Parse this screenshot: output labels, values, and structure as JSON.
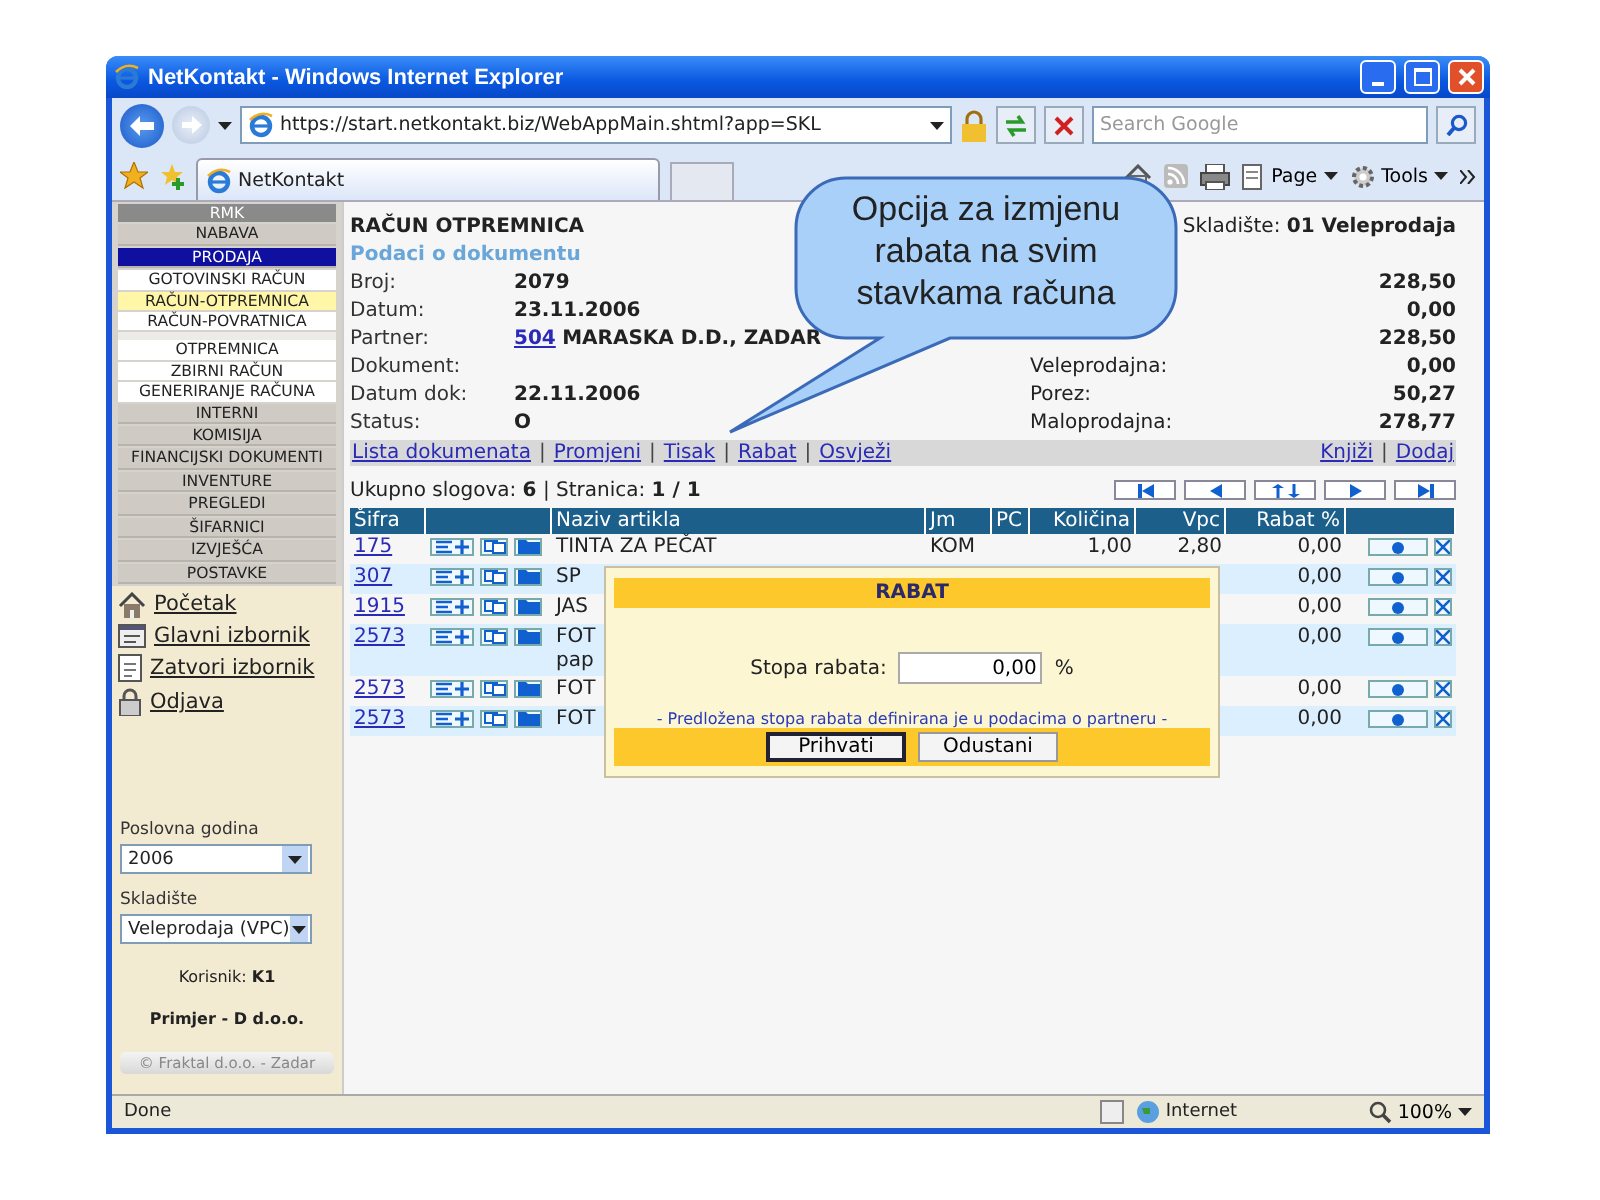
{
  "window": {
    "title": "NetKontakt - Windows Internet Explorer"
  },
  "address_bar": {
    "url": "https://start.netkontakt.biz/WebAppMain.shtml?app=SKL"
  },
  "search": {
    "placeholder": "Search Google"
  },
  "tabs": [
    {
      "label": "NetKontakt",
      "selected": true
    }
  ],
  "command_bar": [
    {
      "label": "Page",
      "kind": "page"
    },
    {
      "label": "Tools",
      "kind": "tools"
    }
  ],
  "sidebar": {
    "menu": [
      {
        "label": "RMK",
        "kind": "header"
      },
      {
        "label": "NABAVA",
        "kind": "category",
        "selected": false
      },
      {
        "label": "PRODAJA",
        "kind": "category",
        "selected": true,
        "children": [
          {
            "label": "GOTOVINSKI RAČUN",
            "selected": false,
            "gap_before": false
          },
          {
            "label": "RAČUN-OTPREMNICA",
            "selected": true,
            "gap_before": false
          },
          {
            "label": "RAČUN-POVRATNICA",
            "selected": false,
            "gap_before": false
          },
          {
            "label": "OTPREMNICA",
            "selected": false,
            "gap_before": true
          },
          {
            "label": "ZBIRNI RAČUN",
            "selected": false,
            "gap_before": false
          },
          {
            "label": "GENERIRANJE RAČUNA",
            "selected": false,
            "gap_before": false
          }
        ]
      },
      {
        "label": "INTERNI",
        "kind": "category",
        "selected": false
      },
      {
        "label": "KOMISIJA",
        "kind": "category",
        "selected": false
      },
      {
        "label": "FINANCIJSKI DOKUMENTI",
        "kind": "category",
        "selected": false
      },
      {
        "label": "INVENTURE",
        "kind": "category",
        "selected": false
      },
      {
        "label": "PREGLEDI",
        "kind": "category",
        "selected": false
      },
      {
        "label": "ŠIFARNICI",
        "kind": "category",
        "selected": false
      },
      {
        "label": "IZVJEŠĆA",
        "kind": "category",
        "selected": false
      },
      {
        "label": "POSTAVKE",
        "kind": "category",
        "selected": false
      }
    ],
    "links": [
      {
        "label": "Početak",
        "kind": "home"
      },
      {
        "label": "Glavni izbornik",
        "kind": "menu"
      },
      {
        "label": "Zatvori izbornik",
        "kind": "close"
      },
      {
        "label": "Odjava",
        "kind": "logout"
      }
    ],
    "year": {
      "label": "Poslovna godina",
      "value": "2006"
    },
    "warehouse": {
      "label": "Skladište",
      "value": "Veleprodaja (VPC)"
    },
    "user": "Korisnik: **K1**",
    "company": "Primjer - D d.o.o.",
    "copyright": "© Fraktal d.o.o. - Zadar"
  },
  "document": {
    "title": "RAČUN OTPREMNICA",
    "warehouse": "Skladište: **01 Veleprodaja**",
    "section": "Podaci o dokumentu",
    "fields_left": [
      {
        "label": "Broj:",
        "value": "2079"
      },
      {
        "label": "Datum:",
        "value": "23.11.2006"
      },
      {
        "label": "Partner:",
        "link": "504",
        "value": "MARASKA D.D., ZADAR"
      },
      {
        "label": "Dokument:"
      },
      {
        "label": "Datum dok:",
        "value": "22.11.2006"
      },
      {
        "label": "Status:",
        "value": "O"
      }
    ],
    "fields_right": [
      {
        "value": "228,50"
      },
      {
        "value": "0,00"
      },
      {
        "value": "228,50"
      },
      {
        "label": "Veleprodajna:",
        "value": "0,00"
      },
      {
        "label": "Porez:",
        "value": "50,27"
      },
      {
        "label": "Maloprodajna:",
        "value": "278,77"
      }
    ],
    "actions_left": [
      "Lista dokumenata",
      "Promjeni",
      "Tisak",
      "Rabat",
      "Osvježi"
    ],
    "actions_right": [
      "Knjiži",
      "Dodaj"
    ],
    "separator": "|",
    "record_info": "Ukupno slogova: **6** | Stranica: **1 / 1**",
    "pager": [
      {
        "kind": "first"
      },
      {
        "kind": "prev"
      },
      {
        "kind": "toggle"
      },
      {
        "kind": "next"
      },
      {
        "kind": "last"
      }
    ],
    "table": {
      "columns": [
        "Šifra",
        "Naziv artikla",
        "Jm",
        "PC",
        "Količina",
        "Vpc",
        "Rabat %"
      ],
      "rows": [
        {
          "code": "175",
          "name": "TINTA ZA PEČAT",
          "unit": "KOM",
          "qty": "1,00",
          "vpc": "2,80",
          "rabat": "0,00"
        },
        {
          "code": "307",
          "name": "SP",
          "rabat": "0,00"
        },
        {
          "code": "1915",
          "name": "JAS",
          "rabat": "0,00"
        },
        {
          "code": "2573",
          "name": "FOT\npap",
          "rabat": "0,00"
        },
        {
          "code": "2573",
          "name": "FOT",
          "rabat": "0,00"
        },
        {
          "code": "2573",
          "name": "FOT",
          "rabat": "0,00"
        }
      ]
    }
  },
  "dialog": {
    "title": "RABAT",
    "label": "Stopa rabata:",
    "value": "0,00",
    "unit": "%",
    "note": "- Predložena stopa rabata definirana je u podacima o partneru -",
    "buttons": [
      {
        "label": "Prihvati",
        "focused": true
      },
      {
        "label": "Odustani",
        "focused": false
      }
    ]
  },
  "callout": {
    "text": "Opcija za izmjenu rabata na svim stavkama računa"
  },
  "status_bar": {
    "text": "Done",
    "zone": "Internet",
    "zoom": "100%"
  }
}
